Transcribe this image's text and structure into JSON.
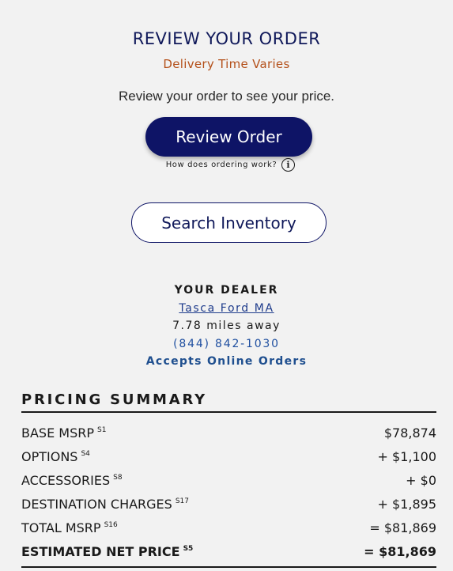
{
  "order": {
    "title": "REVIEW YOUR ORDER",
    "delivery": "Delivery Time Varies",
    "review_text": "Review your order to see your price.",
    "review_button": "Review Order",
    "how_link": "How does ordering work?",
    "info_icon": "i",
    "search_button": "Search Inventory"
  },
  "dealer": {
    "heading": "YOUR DEALER",
    "name": "Tasca Ford MA",
    "distance": "7.78 miles away",
    "phone": "(844) 842-1030",
    "online": "Accepts Online Orders"
  },
  "pricing": {
    "title": "PRICING SUMMARY",
    "rows": [
      {
        "label": "BASE MSRP",
        "sup": "S1",
        "value": "$78,874"
      },
      {
        "label": "OPTIONS",
        "sup": "S4",
        "value": "+ $1,100"
      },
      {
        "label": "ACCESSORIES",
        "sup": "S8",
        "value": "+ $0"
      },
      {
        "label": "DESTINATION CHARGES",
        "sup": "S17",
        "value": "+ $1,895"
      },
      {
        "label": "TOTAL MSRP",
        "sup": "S16",
        "value": "= $81,869"
      },
      {
        "label": "ESTIMATED NET PRICE",
        "sup": "S5",
        "value": "= $81,869"
      }
    ]
  },
  "colors": {
    "navy": "#0e1466",
    "delivery": "#b4501a",
    "link": "#1f3c8c"
  }
}
